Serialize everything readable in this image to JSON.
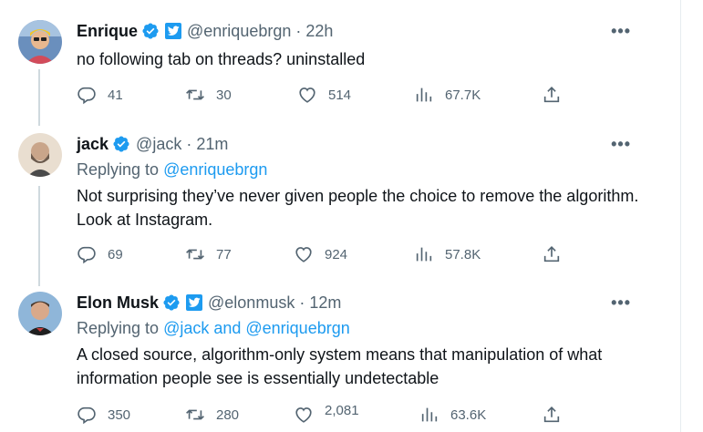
{
  "tweets": [
    {
      "name": "Enrique",
      "handle": "@enriquebrgn",
      "time": "22h",
      "text": "no following tab on threads? uninstalled",
      "replying_prefix": "",
      "replying_to": "",
      "stats": {
        "replies": "41",
        "retweets": "30",
        "likes": "514",
        "views": "67.7K"
      },
      "has_twitter_badge": true
    },
    {
      "name": "jack",
      "handle": "@jack",
      "time": "21m",
      "replying_prefix": "Replying to ",
      "replying_to": "@enriquebrgn",
      "text": "Not surprising they’ve never given people the choice to remove the algorithm. Look at Instagram.",
      "stats": {
        "replies": "69",
        "retweets": "77",
        "likes": "924",
        "views": "57.8K"
      },
      "has_twitter_badge": false
    },
    {
      "name": "Elon Musk",
      "handle": "@elonmusk",
      "time": "12m",
      "replying_prefix": "Replying to ",
      "replying_to": "@jack and @enriquebrgn",
      "text": "A closed source, algorithm-only system means that manipulation of what information people see is essentially undetectable",
      "stats": {
        "replies": "350",
        "retweets": "280",
        "likes": "2,081",
        "views": "63.6K"
      },
      "has_twitter_badge": true
    }
  ],
  "ui": {
    "separator": "·",
    "more": "•••"
  },
  "icons": {
    "reply": "reply-icon",
    "retweet": "retweet-icon",
    "like": "heart-icon",
    "views": "views-icon",
    "share": "share-icon",
    "verified": "verified-badge-icon",
    "twitter": "twitter-bird-icon"
  },
  "colors": {
    "accent": "#1d9bf0",
    "text": "#0f1419",
    "muted": "#536471",
    "thread_line": "#cfd9de"
  }
}
